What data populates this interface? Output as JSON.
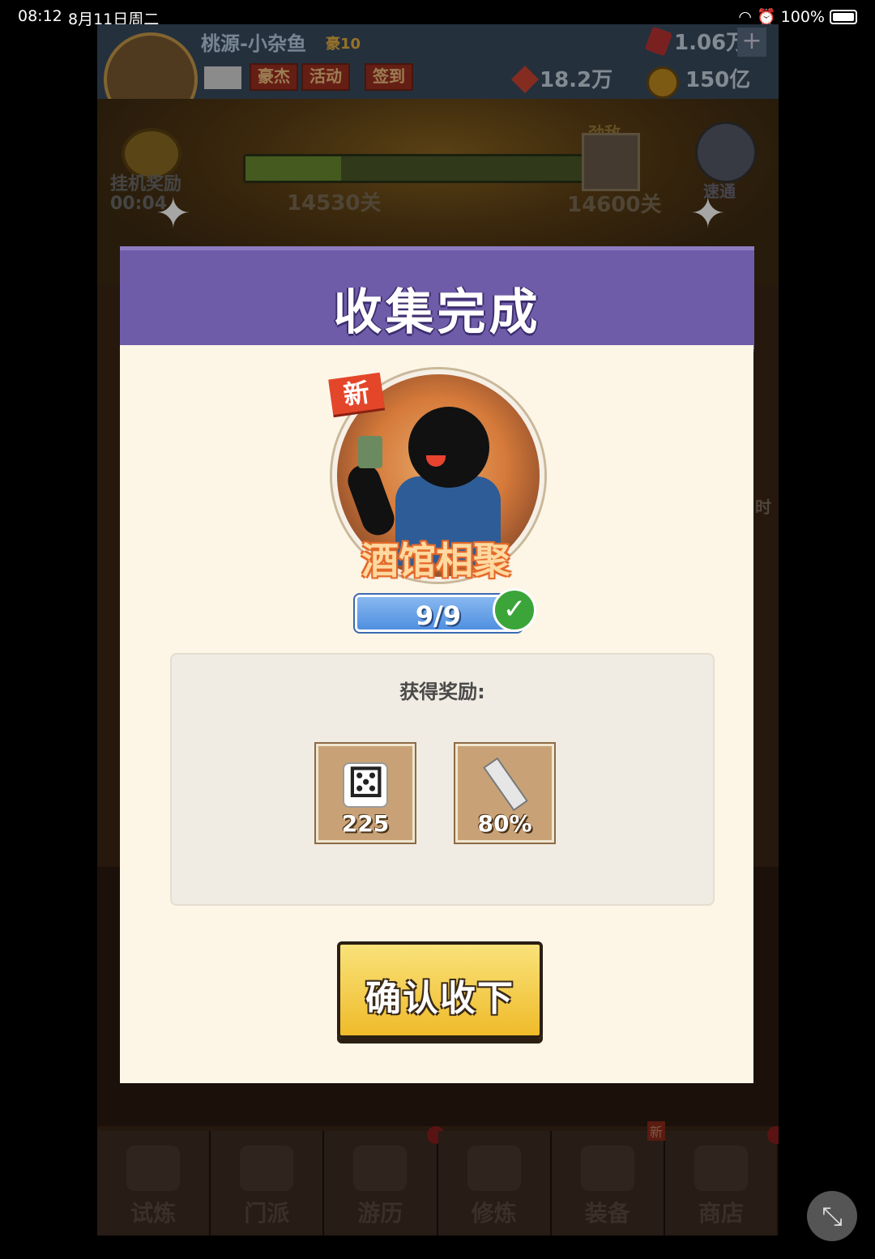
{
  "status_bar": {
    "time": "08:12",
    "date": "8月11日周二",
    "battery": "100%"
  },
  "game_header": {
    "player_name": "桃源-小杂鱼",
    "vip_tag": "豪10",
    "buttons": [
      "豪杰",
      "活动",
      "签到"
    ],
    "currency_gem": "1.06万",
    "currency_red": "18.2万",
    "currency_coin": "150亿"
  },
  "stage": {
    "idle_reward_label": "挂机奖励",
    "idle_timer": "00:04",
    "current_stage": "14530关",
    "boss_stage": "14600关",
    "boss_tag": "劲敌",
    "sweep_label": "速通",
    "progress": 0.28
  },
  "modal": {
    "title": "收集完成",
    "new_badge": "新",
    "collection_name": "酒馆相聚",
    "count": "9/9",
    "rewards_title": "获得奖励:",
    "rewards": [
      {
        "icon": "dice-icon",
        "qty": "225"
      },
      {
        "icon": "sword-icon",
        "qty": "80%"
      }
    ],
    "confirm_label": "确认收下"
  },
  "bottom_nav": [
    {
      "label": "试炼",
      "badge": ""
    },
    {
      "label": "门派",
      "badge": ""
    },
    {
      "label": "游历",
      "badge": "dot"
    },
    {
      "label": "修炼",
      "badge": ""
    },
    {
      "label": "装备",
      "badge": "新"
    },
    {
      "label": "商店",
      "badge": "dot"
    }
  ],
  "side_hint": "时"
}
